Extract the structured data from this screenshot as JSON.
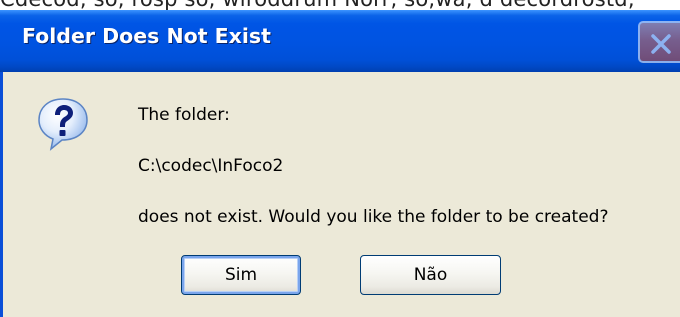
{
  "behind_text": "Cdecod, so, rosp so, wiroddrum Norr, so,wa, d decordrostd,",
  "dialog": {
    "title": "Folder Does Not Exist",
    "icon": "question-icon",
    "line1": "The folder:",
    "path": "C:\\codec\\InFoco2",
    "line3": "does not exist. Would you like the folder to be created?",
    "yes_label": "Sim",
    "no_label": "Não"
  },
  "colors": {
    "titlebar": "#0053e1",
    "dialog_bg": "#ece9d8",
    "button_border": "#003c74",
    "close_button": "#d9684a"
  }
}
